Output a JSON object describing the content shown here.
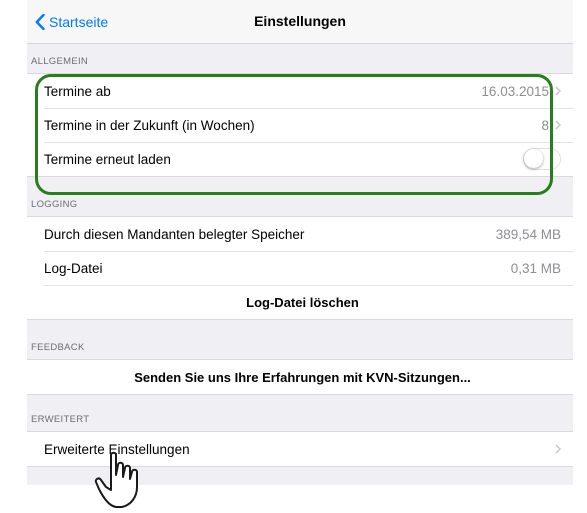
{
  "navbar": {
    "back_label": "Startseite",
    "title": "Einstellungen"
  },
  "sections": {
    "allgemein": {
      "header": "ALLGEMEIN",
      "rows": [
        {
          "label": "Termine ab",
          "value": "16.03.2015"
        },
        {
          "label": "Termine in der Zukunft (in Wochen)",
          "value": "8"
        },
        {
          "label": "Termine erneut laden",
          "toggle_on": false
        }
      ]
    },
    "logging": {
      "header": "LOGGING",
      "rows": [
        {
          "label": "Durch diesen Mandanten belegter Speicher",
          "value": "389,54 MB"
        },
        {
          "label": "Log-Datei",
          "value": "0,31 MB"
        },
        {
          "label": "Log-Datei löschen"
        }
      ]
    },
    "feedback": {
      "header": "FEEDBACK",
      "rows": [
        {
          "label": "Senden Sie uns Ihre Erfahrungen mit KVN-Sitzungen..."
        }
      ]
    },
    "erweitert": {
      "header": "ERWEITERT",
      "rows": [
        {
          "label": "Erweiterte Einstellungen"
        }
      ]
    }
  },
  "colors": {
    "accent": "#007aff",
    "highlight": "#267f1c",
    "background": "#efeff4"
  }
}
